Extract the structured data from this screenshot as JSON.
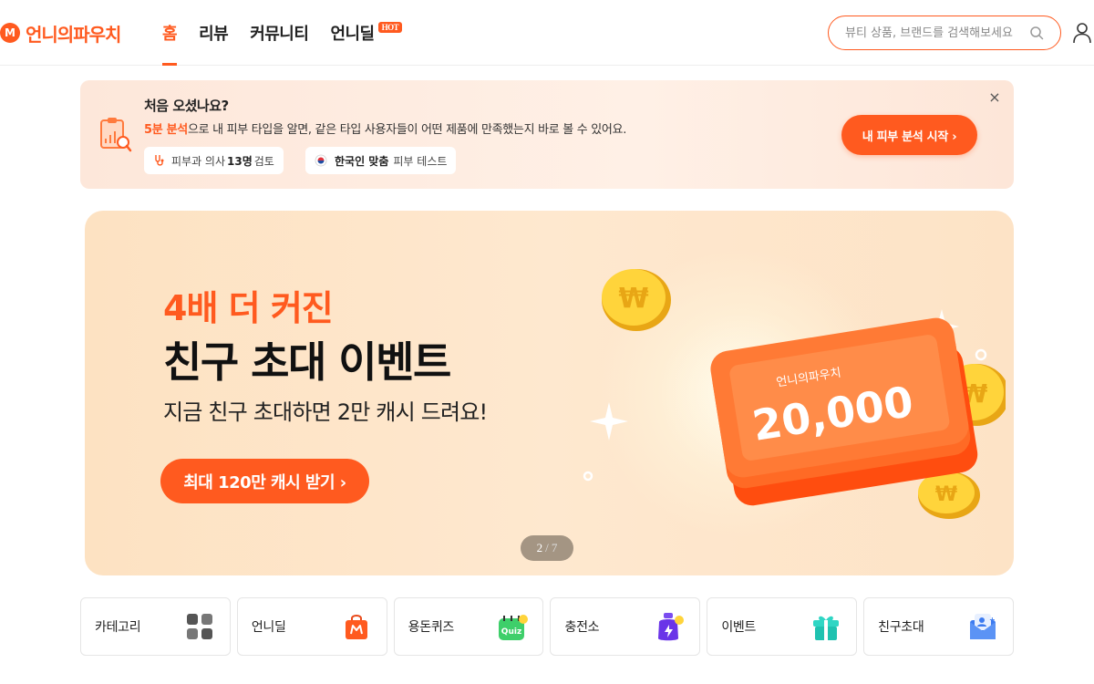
{
  "header": {
    "logo_text": "언니의파우치",
    "logo_mark": "M",
    "nav": [
      {
        "label": "홈",
        "active": true
      },
      {
        "label": "리뷰",
        "active": false
      },
      {
        "label": "커뮤니티",
        "active": false
      },
      {
        "label": "언니딜",
        "active": false,
        "badge": "HOT"
      }
    ],
    "search_placeholder": "뷰티 상품, 브랜드를 검색해보세요",
    "icons": {
      "search": "search-icon",
      "user": "user-icon"
    }
  },
  "onboarding": {
    "title": "처음 오셨나요?",
    "desc_highlight": "5분 분석",
    "desc_rest": "으로 내 피부 타입을 알면, 같은 타입 사용자들이 어떤 제품에 만족했는지 바로 볼 수 있어요.",
    "chip1": {
      "pre": "피부과 의사",
      "bold": "13명",
      "post": "검토"
    },
    "chip2": {
      "bold": "한국인 맞춤",
      "post": "피부 테스트"
    },
    "button": "내 피부 분석 시작 ›",
    "close": "×"
  },
  "hero": {
    "kicker": "4배 더 커진",
    "title": "친구 초대 이벤트",
    "subtitle": "지금 친구 초대하면 2만 캐시 드려요!",
    "cta": "최대 120만 캐시 받기 ›",
    "ticket_brand": "언니의파우치",
    "ticket_amount": "20,000",
    "pager": {
      "current": "2",
      "total": "/ 7"
    }
  },
  "quick_menu": [
    {
      "label": "카테고리",
      "icon": "category-grid-icon"
    },
    {
      "label": "언니딜",
      "icon": "shopping-bag-icon"
    },
    {
      "label": "용돈퀴즈",
      "icon": "quiz-icon"
    },
    {
      "label": "충전소",
      "icon": "charge-pouch-icon"
    },
    {
      "label": "이벤트",
      "icon": "gift-icon"
    },
    {
      "label": "친구초대",
      "icon": "invite-envelope-icon"
    }
  ],
  "colors": {
    "brand": "#ff5a1f"
  }
}
